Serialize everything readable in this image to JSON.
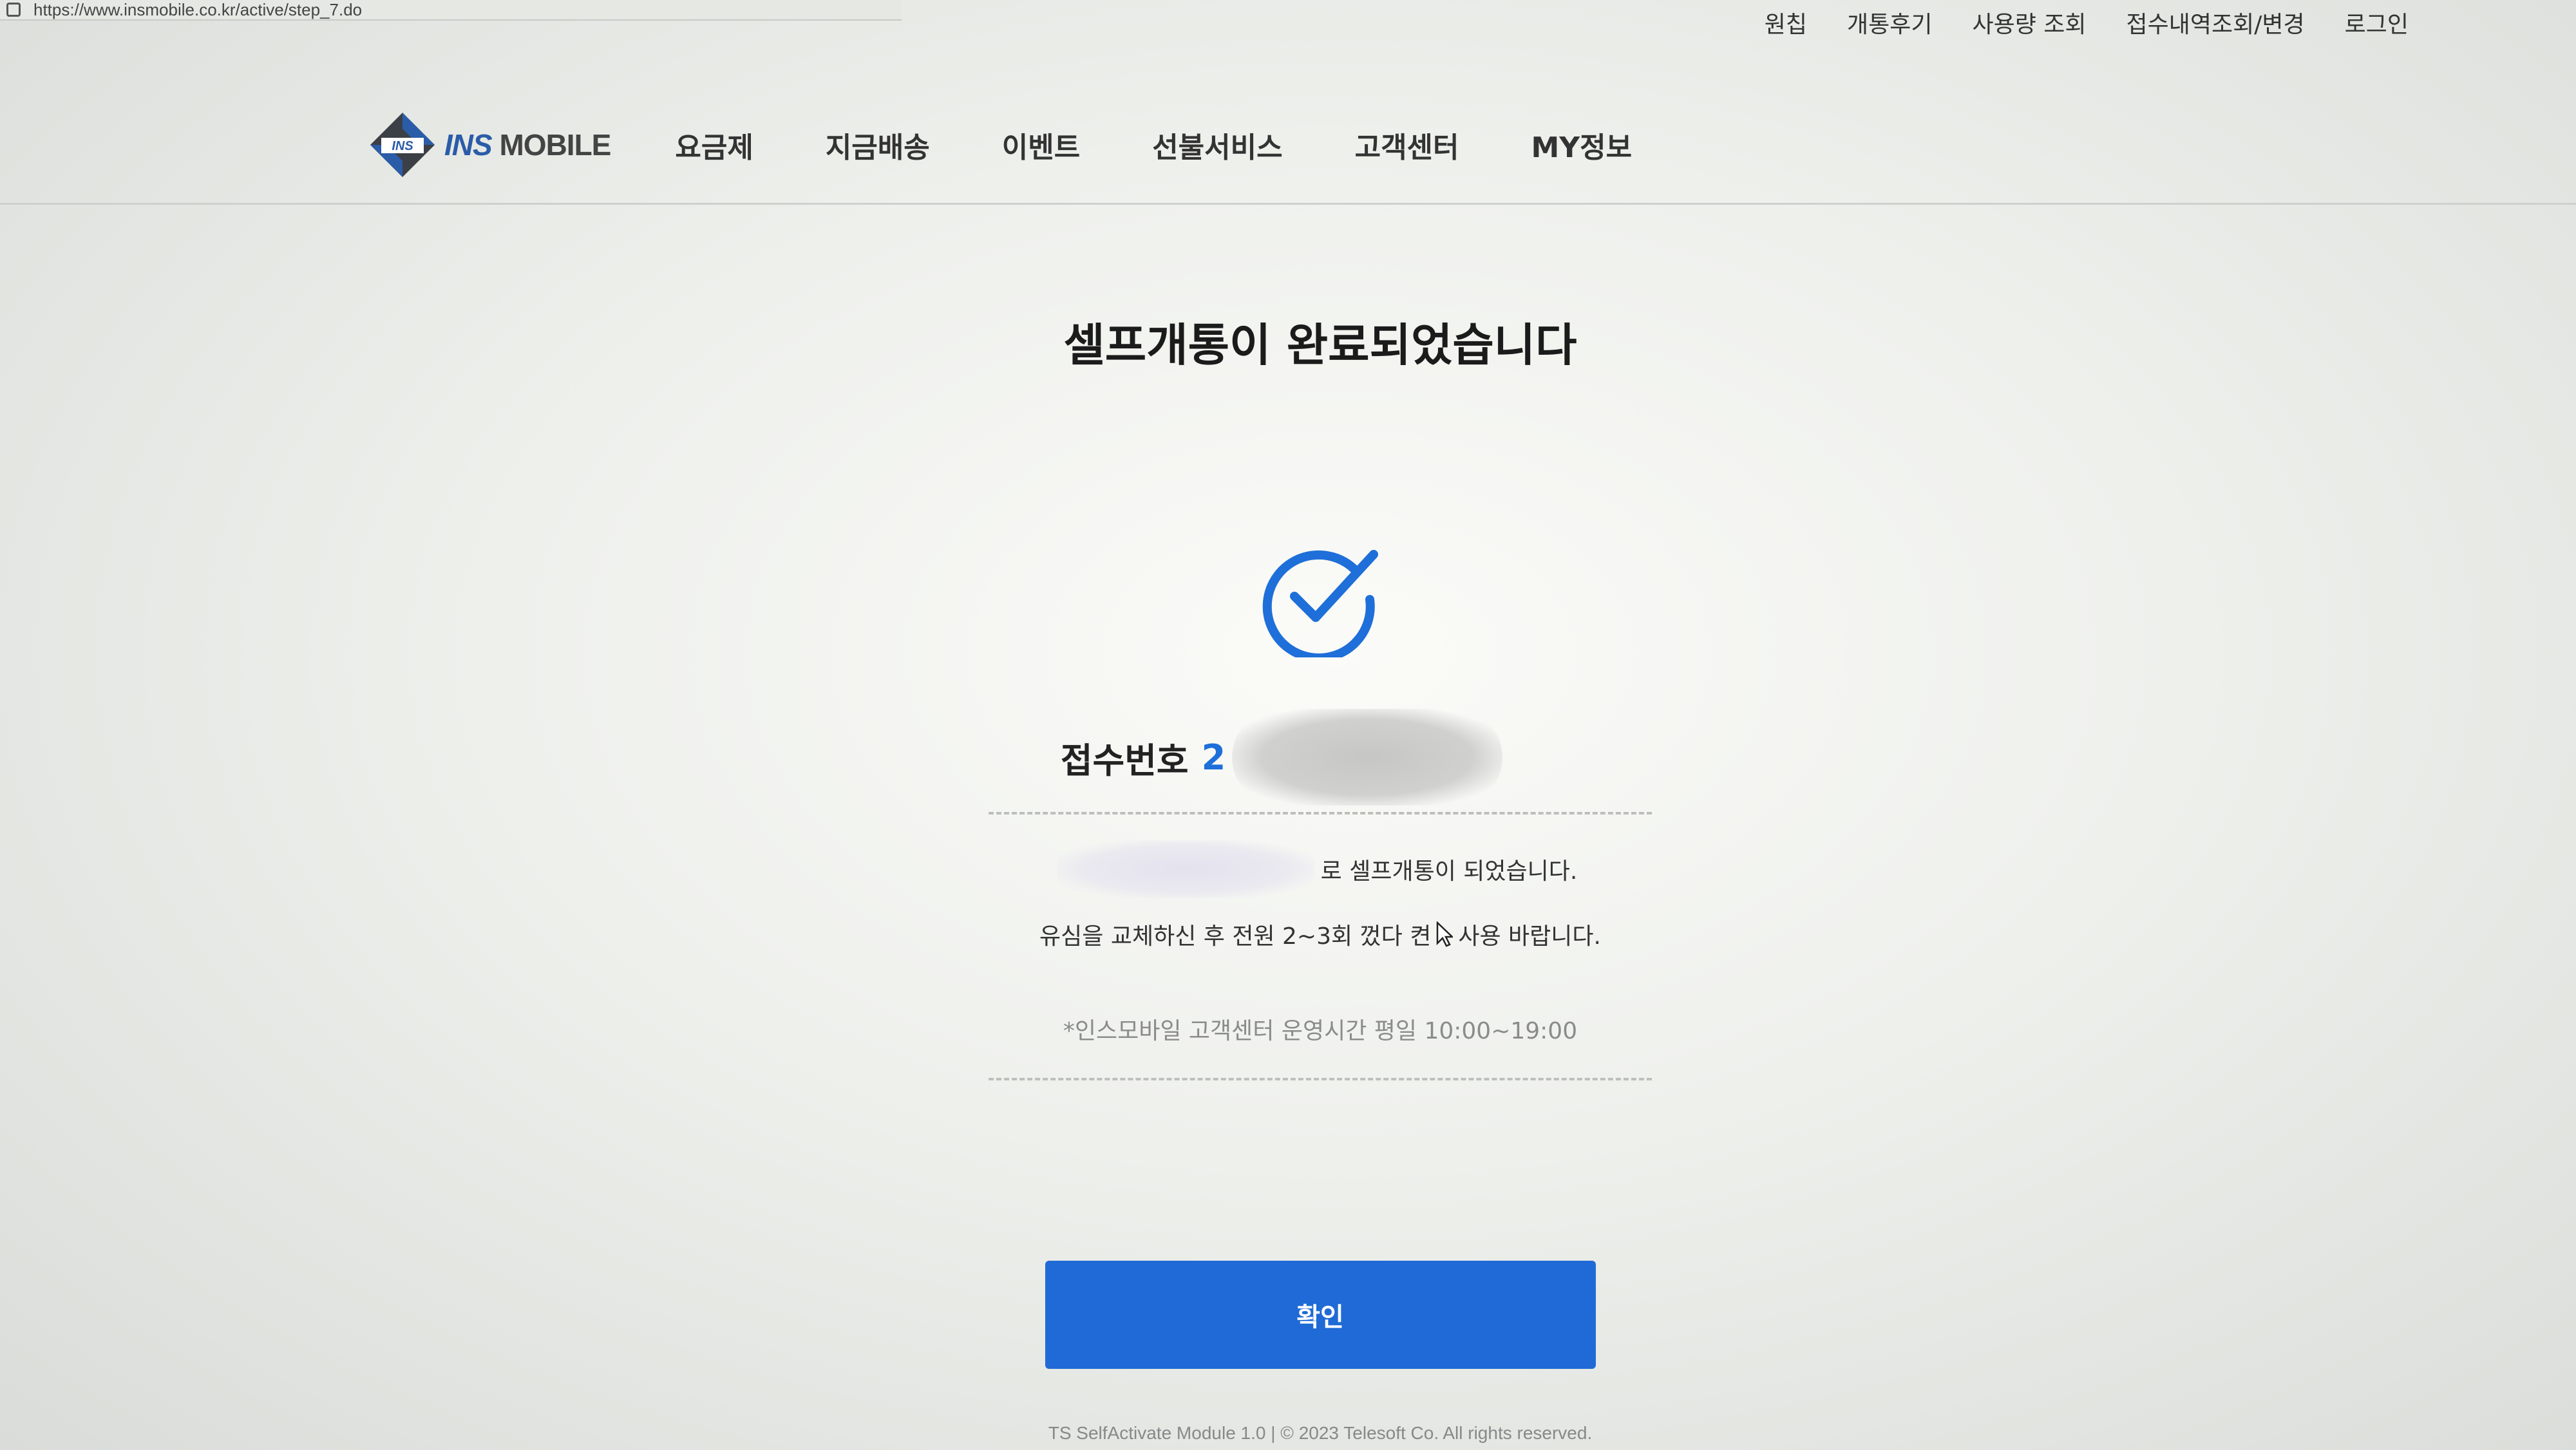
{
  "browser": {
    "url": "https://www.insmobile.co.kr/active/step_7.do"
  },
  "utility_nav": [
    "원칩",
    "개통후기",
    "사용량 조회",
    "접수내역조회/변경",
    "로그인"
  ],
  "logo": {
    "ins": "INS",
    "mobile": "MOBILE"
  },
  "main_nav": [
    "요금제",
    "지금배송",
    "이벤트",
    "선불서비스",
    "고객센터",
    "MY정보"
  ],
  "page": {
    "title": "셀프개통이 완료되었습니다",
    "receipt_label": "접수번호",
    "receipt_number_visible": "2",
    "message1": "로 셀프개통이 되었습니다.",
    "message2_part1": "유심을 교체하신 후 전원 2~3회 껐다 켠",
    "message2_part2": "사용 바랍니다.",
    "hours": "*인스모바일 고객센터 운영시간 평일 10:00~19:00",
    "confirm_label": "확인"
  },
  "footer": "TS SelfActivate Module 1.0 | © 2023 Telesoft Co. All rights reserved.",
  "colors": {
    "accent": "#1f6ad6",
    "check": "#1e6fd9"
  },
  "icons": {
    "check": "check-circle-icon",
    "cursor": "mouse-pointer-icon",
    "lock": "lock-icon"
  }
}
